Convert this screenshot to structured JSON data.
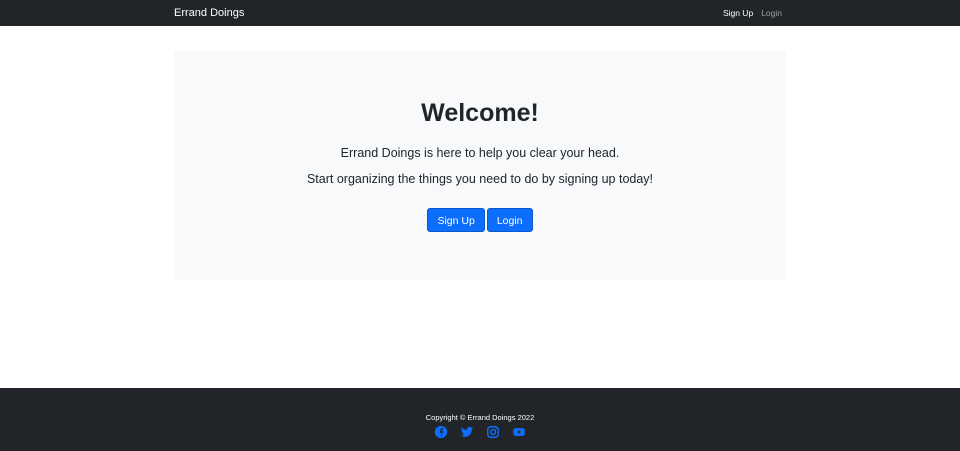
{
  "navbar": {
    "brand": "Errand Doings",
    "links": [
      {
        "label": "Sign Up"
      },
      {
        "label": "Login"
      }
    ]
  },
  "hero": {
    "title": "Welcome!",
    "line1": "Errand Doings is here to help you clear your head.",
    "line2": "Start organizing the things you need to do by signing up today!",
    "signup_label": "Sign Up",
    "login_label": "Login"
  },
  "footer": {
    "copyright": "Copyright © Errand Doings 2022",
    "socials": [
      {
        "icon": "facebook-icon"
      },
      {
        "icon": "twitter-icon"
      },
      {
        "icon": "instagram-icon"
      },
      {
        "icon": "youtube-icon"
      }
    ]
  },
  "colors": {
    "navbar_bg": "#212529",
    "hero_bg": "#f8f9fa",
    "primary": "#0d6efd"
  }
}
